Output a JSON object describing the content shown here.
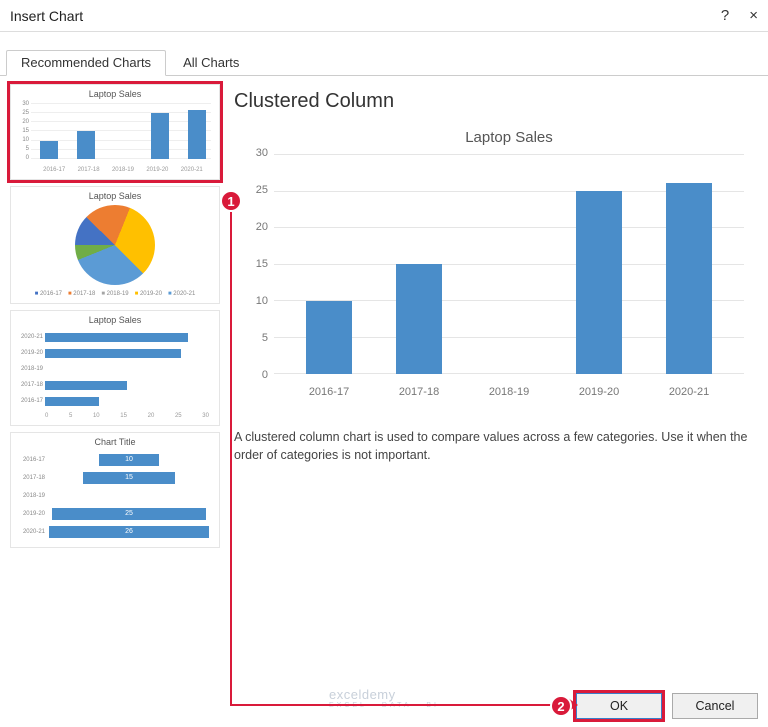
{
  "titlebar": {
    "title": "Insert Chart",
    "help": "?",
    "close": "×"
  },
  "tabs": [
    {
      "label": "Recommended Charts",
      "active": true
    },
    {
      "label": "All Charts",
      "active": false
    }
  ],
  "thumbnails": {
    "column": {
      "title": "Laptop Sales",
      "yticks": [
        "30",
        "25",
        "20",
        "15",
        "10",
        "5",
        "0"
      ],
      "cats": [
        "2016-17",
        "2017-18",
        "2018-19",
        "2019-20",
        "2020-21"
      ]
    },
    "pie": {
      "title": "Laptop Sales",
      "legend": [
        "2016-17",
        "2017-18",
        "2018-19",
        "2019-20",
        "2020-21"
      ]
    },
    "hbar": {
      "title": "Laptop Sales",
      "ycats": [
        "2020-21",
        "2019-20",
        "2018-19",
        "2017-18",
        "2016-17"
      ],
      "xticks": [
        "0",
        "5",
        "10",
        "15",
        "20",
        "25",
        "30"
      ]
    },
    "funnel": {
      "title": "Chart Title",
      "rows": [
        {
          "label": "2016-17",
          "val": "10"
        },
        {
          "label": "2017-18",
          "val": "15"
        },
        {
          "label": "2018-19",
          "val": ""
        },
        {
          "label": "2019-20",
          "val": "25"
        },
        {
          "label": "2020-21",
          "val": "26"
        }
      ]
    }
  },
  "main": {
    "heading": "Clustered Column",
    "chart_title": "Laptop Sales",
    "yticks": [
      "30",
      "25",
      "20",
      "15",
      "10",
      "5",
      "0"
    ],
    "xcats": [
      "2016-17",
      "2017-18",
      "2018-19",
      "2019-20",
      "2020-21"
    ],
    "description": "A clustered column chart is used to compare values across a few categories. Use it when the order of categories is not important."
  },
  "footer": {
    "ok": "OK",
    "cancel": "Cancel"
  },
  "watermark": {
    "name": "exceldemy",
    "sub": "EXCEL · DATA · BI"
  },
  "callouts": {
    "one": "1",
    "two": "2"
  },
  "chart_data": {
    "type": "bar",
    "title": "Laptop Sales",
    "categories": [
      "2016-17",
      "2017-18",
      "2018-19",
      "2019-20",
      "2020-21"
    ],
    "values": [
      10,
      15,
      0,
      25,
      26
    ],
    "xlabel": "",
    "ylabel": "",
    "ylim": [
      0,
      30
    ]
  }
}
